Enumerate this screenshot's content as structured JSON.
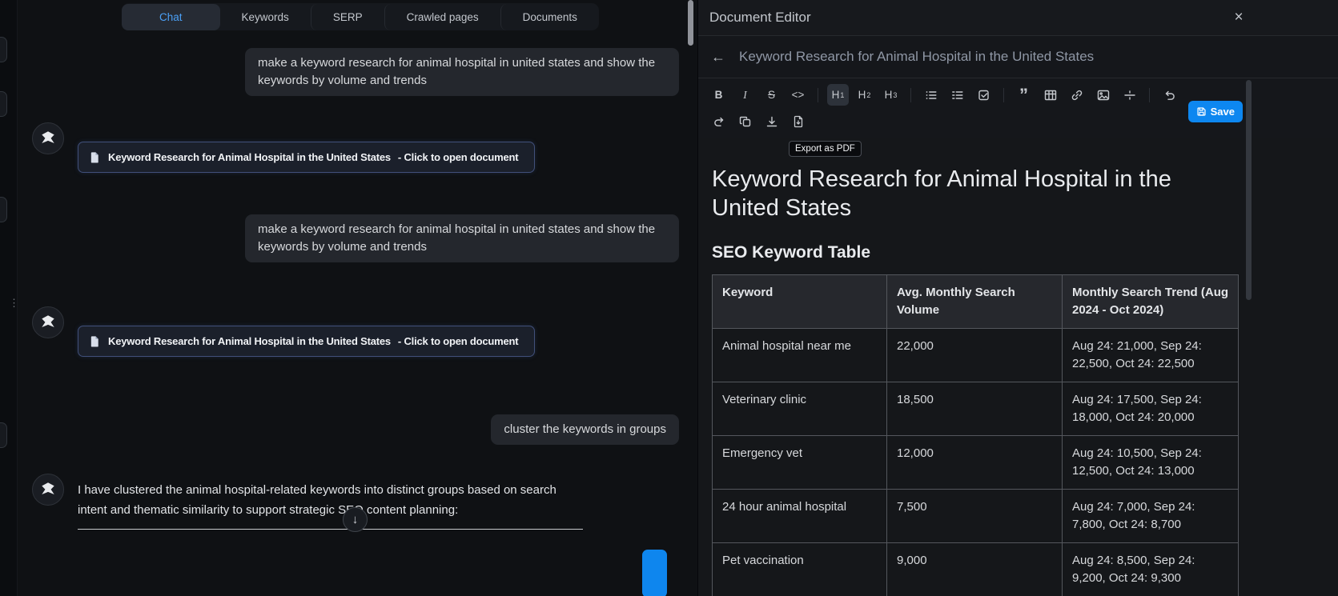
{
  "chat": {
    "tabs": [
      "Chat",
      "Keywords",
      "SERP",
      "Crawled pages",
      "Documents"
    ],
    "messages": [
      {
        "role": "user",
        "text": "make a keyword research for animal hospital in united states and show the keywords by volume and trends"
      },
      {
        "role": "assistant-doc",
        "title": "Keyword Research for Animal Hospital in the United States",
        "suffix": "- Click to open document"
      },
      {
        "role": "user",
        "text": "make a keyword research for animal hospital in united states and show the keywords by volume and trends"
      },
      {
        "role": "assistant-doc",
        "title": "Keyword Research for Animal Hospital in the United States",
        "suffix": "- Click to open document"
      },
      {
        "role": "user",
        "text": "cluster the keywords in groups"
      },
      {
        "role": "assistant",
        "text": "I have clustered the animal hospital-related keywords into distinct groups based on search intent and thematic similarity to support strategic SEO content planning:"
      }
    ],
    "scroll_down_glyph": "↓",
    "drag_handle_glyph": "⋮⋮"
  },
  "editor": {
    "panel_title": "Document Editor",
    "close_glyph": "×",
    "back_glyph": "←",
    "doc_title": "Keyword Research for Animal Hospital in the United States",
    "toolbar": {
      "bold": "B",
      "italic": "I",
      "strike": "S",
      "code": "<>",
      "h": "H",
      "h1_sub": "1",
      "h2_sub": "2",
      "h3_sub": "3",
      "quote": "”",
      "save": "Save",
      "tooltip": "Export as PDF"
    },
    "document": {
      "heading": "Keyword Research for Animal Hospital in the United States",
      "subheading": "SEO Keyword Table",
      "table": {
        "headers": [
          "Keyword",
          "Avg. Monthly Search Volume",
          "Monthly Search Trend (Aug 2024 - Oct 2024)"
        ],
        "rows": [
          [
            "Animal hospital near me",
            "22,000",
            "Aug 24: 21,000, Sep 24: 22,500, Oct 24: 22,500"
          ],
          [
            "Veterinary clinic",
            "18,500",
            "Aug 24: 17,500, Sep 24: 18,000, Oct 24: 20,000"
          ],
          [
            "Emergency vet",
            "12,000",
            "Aug 24: 10,500, Sep 24: 12,500, Oct 24: 13,000"
          ],
          [
            "24 hour animal hospital",
            "7,500",
            "Aug 24: 7,000, Sep 24: 7,800, Oct 24: 8,700"
          ],
          [
            "Pet vaccination",
            "9,000",
            "Aug 24: 8,500, Sep 24: 9,200, Oct 24: 9,300"
          ]
        ]
      }
    }
  },
  "colors": {
    "accent": "#4ba0f6",
    "save_button": "#0d87f0",
    "doc_card_border": "#41507a"
  }
}
